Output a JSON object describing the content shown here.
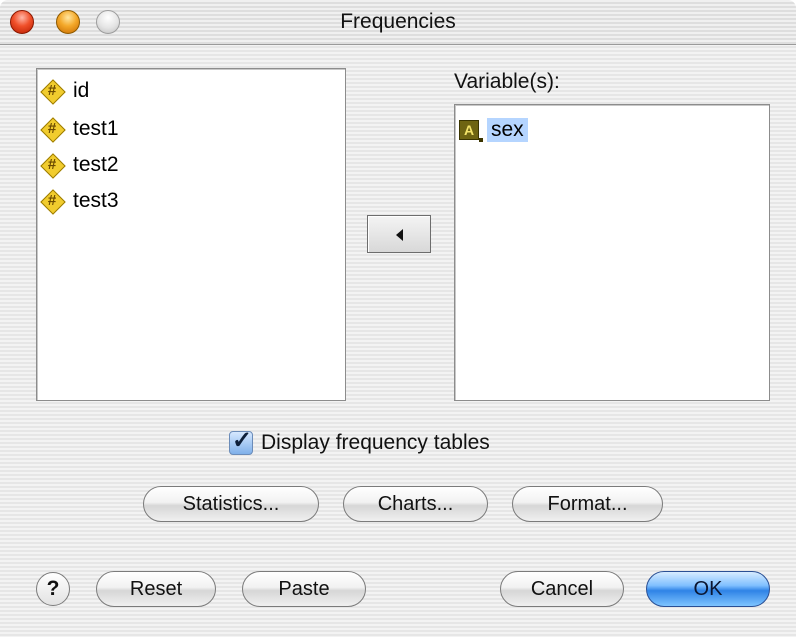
{
  "window": {
    "title": "Frequencies"
  },
  "source_list": {
    "items": [
      {
        "label": "id",
        "icon": "scale-variable-icon"
      },
      {
        "label": "test1",
        "icon": "scale-variable-icon"
      },
      {
        "label": "test2",
        "icon": "scale-variable-icon"
      },
      {
        "label": "test3",
        "icon": "scale-variable-icon"
      }
    ]
  },
  "target_list": {
    "label": "Variable(s):",
    "items": [
      {
        "label": "sex",
        "icon": "string-variable-icon",
        "icon_glyph": "A",
        "selected": true
      }
    ]
  },
  "move_button": {
    "icon": "left-arrow-icon"
  },
  "checkbox": {
    "label": "Display frequency tables",
    "checked": true
  },
  "buttons": {
    "statistics": "Statistics...",
    "charts": "Charts...",
    "format": "Format...",
    "help": "?",
    "reset": "Reset",
    "paste": "Paste",
    "cancel": "Cancel",
    "ok": "OK"
  },
  "colors": {
    "default_button": "#2f83e6",
    "selection_highlight": "#b5d5ff",
    "scale_icon": "#f1cc2e",
    "string_icon": "#6e6412"
  }
}
